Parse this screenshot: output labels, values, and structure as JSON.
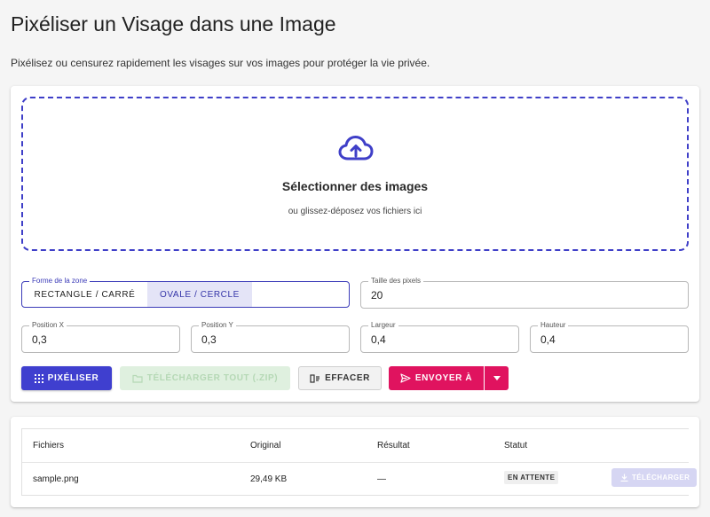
{
  "header": {
    "title": "Pixéliser un Visage dans une Image",
    "subtitle": "Pixélisez ou censurez rapidement les visages sur vos images pour protéger la vie privée."
  },
  "dropzone": {
    "icon": "cloud-upload-icon",
    "title": "Sélectionner des images",
    "subtitle": "ou glissez-déposez vos fichiers ici"
  },
  "settings": {
    "shape": {
      "label": "Forme de la zone",
      "options": [
        "RECTANGLE / CARRÉ",
        "OVALE / CERCLE"
      ],
      "selected": "OVALE / CERCLE"
    },
    "pixel_size": {
      "label": "Taille des pixels",
      "value": "20"
    },
    "pos_x": {
      "label": "Position X",
      "value": "0,3"
    },
    "pos_y": {
      "label": "Position Y",
      "value": "0,3"
    },
    "width": {
      "label": "Largeur",
      "value": "0,4"
    },
    "height": {
      "label": "Hauteur",
      "value": "0,4"
    }
  },
  "actions": {
    "pixelize": "PIXÉLISER",
    "download_all": "TÉLÉCHARGER TOUT (.ZIP)",
    "clear": "EFFACER",
    "send_to": "ENVOYER À"
  },
  "table": {
    "columns": [
      "Fichiers",
      "Original",
      "Résultat",
      "Statut"
    ],
    "rows": [
      {
        "file": "sample.png",
        "original": "29,49 KB",
        "result": "—",
        "status": "EN ATTENTE",
        "download": "TÉLÉCHARGER"
      }
    ]
  },
  "colors": {
    "primary": "#3f3fcf",
    "send": "#e0135f",
    "disabled_green": "#dff0df"
  }
}
